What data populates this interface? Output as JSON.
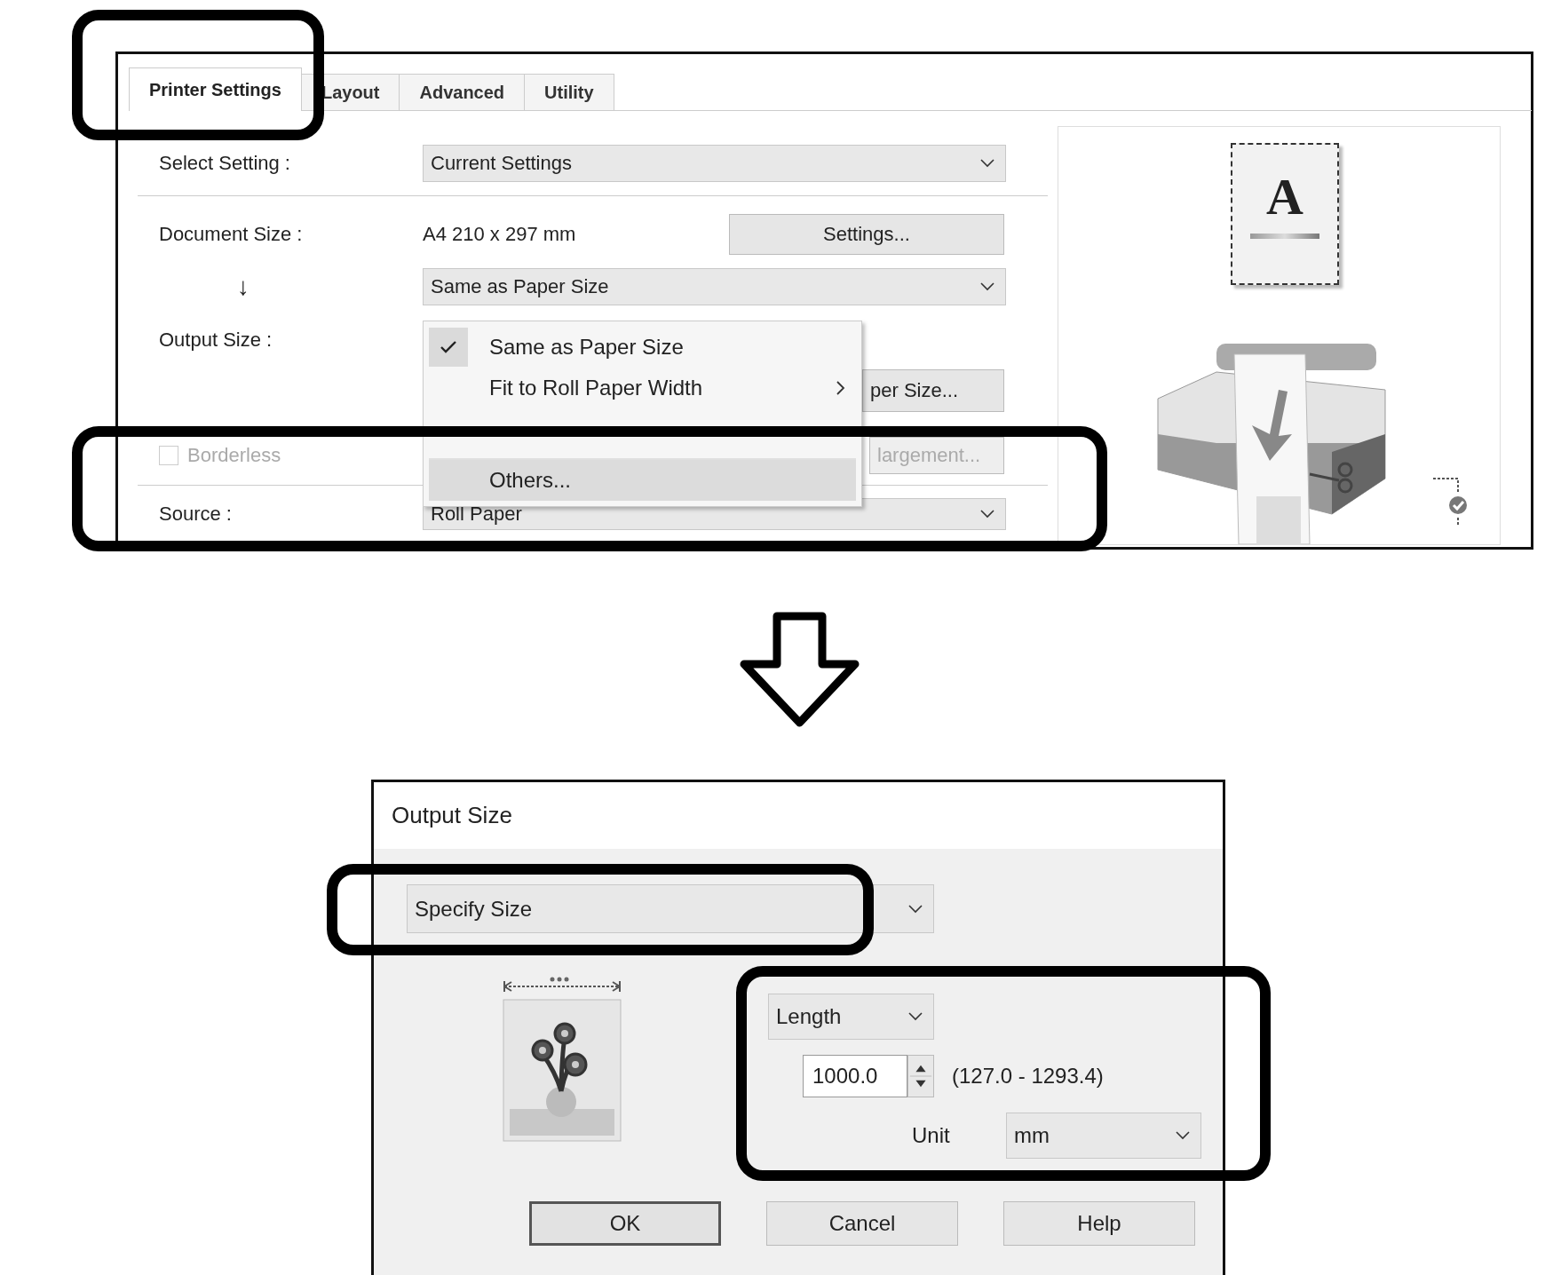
{
  "printer_settings_window": {
    "tabs": [
      {
        "label": "Printer Settings",
        "selected": true
      },
      {
        "label": "Layout",
        "selected": false
      },
      {
        "label": "Advanced",
        "selected": false
      },
      {
        "label": "Utility",
        "selected": false
      }
    ],
    "select_setting": {
      "label": "Select Setting :",
      "value": "Current Settings"
    },
    "document_size": {
      "label": "Document Size :",
      "value": "A4 210 x 297 mm",
      "button": "Settings..."
    },
    "size_arrow": "↓",
    "output_size": {
      "label": "Output Size :",
      "value": "Same as Paper Size",
      "button": "per Size..."
    },
    "size_menu": [
      {
        "label": "Same as Paper Size",
        "checked": true,
        "submenu": false,
        "selected": false,
        "separator_before": false
      },
      {
        "label": "Fit to Roll Paper Width",
        "checked": false,
        "submenu": true,
        "selected": false,
        "separator_before": false
      },
      {
        "label": "Others...",
        "checked": false,
        "submenu": false,
        "selected": true,
        "separator_before": true
      }
    ],
    "borderless": {
      "label": "Borderless",
      "checked": false,
      "disabled": true
    },
    "enlargement_button": {
      "label": "largement...",
      "disabled": true
    },
    "source": {
      "label": "Source :",
      "value": "Roll Paper"
    },
    "preview": {
      "paper_letter": "A"
    }
  },
  "output_size_dialog": {
    "title": "Output Size",
    "mode": "Specify Size",
    "dimension": "Length",
    "value": "1000.0",
    "range": "(127.0 - 1293.4)",
    "unit_label": "Unit",
    "unit": "mm",
    "buttons": [
      {
        "label": "OK",
        "default": true
      },
      {
        "label": "Cancel",
        "default": false
      },
      {
        "label": "Help",
        "default": false
      }
    ]
  }
}
